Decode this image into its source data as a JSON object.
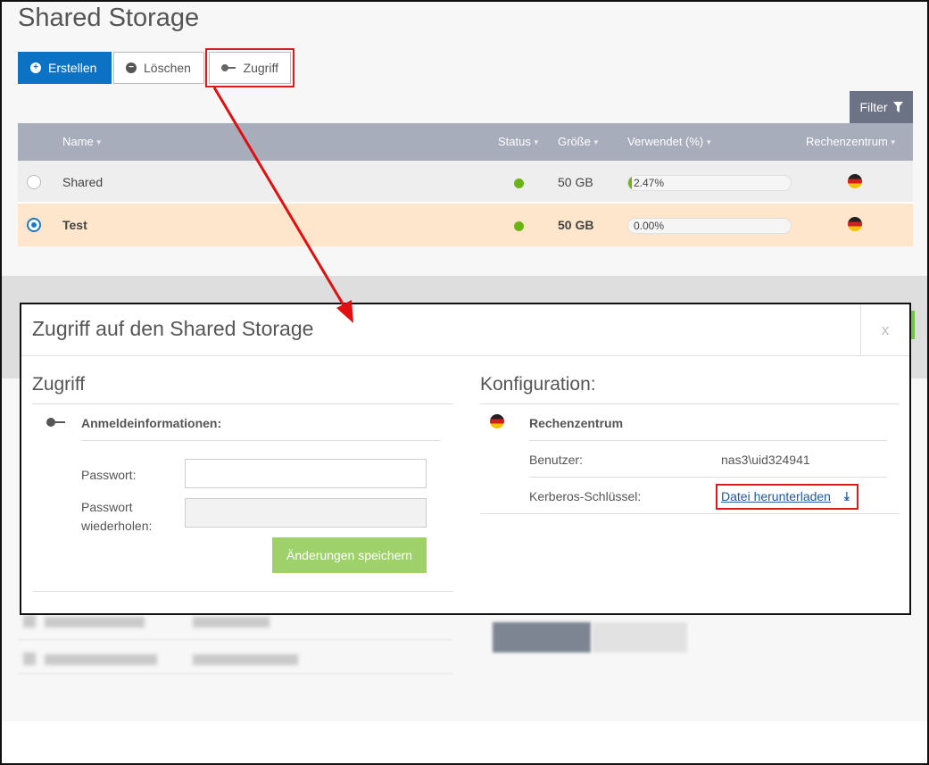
{
  "page": {
    "title": "Shared Storage",
    "buttons": {
      "create": "Erstellen",
      "delete": "Löschen",
      "access": "Zugriff"
    },
    "filter_label": "Filter"
  },
  "table": {
    "headers": {
      "name": "Name",
      "status": "Status",
      "size": "Größe",
      "used": "Verwendet (%)",
      "datacenter": "Rechenzentrum"
    },
    "rows": [
      {
        "name": "Shared",
        "status": "online",
        "size": "50 GB",
        "used": "2.47%",
        "used_fraction": 0.0247,
        "selected": false
      },
      {
        "name": "Test",
        "status": "online",
        "size": "50 GB",
        "used": "0.00%",
        "used_fraction": 0.0,
        "selected": true
      }
    ]
  },
  "modal": {
    "title": "Zugriff auf den Shared Storage",
    "close_label": "x",
    "access": {
      "section_title": "Zugriff",
      "credentials_heading": "Anmeldeinformationen:",
      "password_label": "Passwort:",
      "password_repeat_label_line1": "Passwort",
      "password_repeat_label_line2": "wiederholen:",
      "save_button": "Änderungen speichern"
    },
    "config": {
      "section_title": "Konfiguration:",
      "datacenter_label": "Rechenzentrum",
      "user_label": "Benutzer:",
      "user_value": "nas3\\uid324941",
      "kerberos_label": "Kerberos-Schlüssel:",
      "download_link": "Datei herunterladen"
    }
  },
  "colors": {
    "primary": "#0c72c3",
    "table_header": "#a7adbb",
    "selected_row": "#fde6cc",
    "status_online": "#6ab515",
    "save_button": "#9ed16a",
    "annotation": "#d41e1e"
  },
  "icons": [
    "plus-circle-icon",
    "minus-circle-icon",
    "key-icon",
    "filter-icon",
    "germany-flag-icon",
    "download-icon",
    "close-icon"
  ]
}
